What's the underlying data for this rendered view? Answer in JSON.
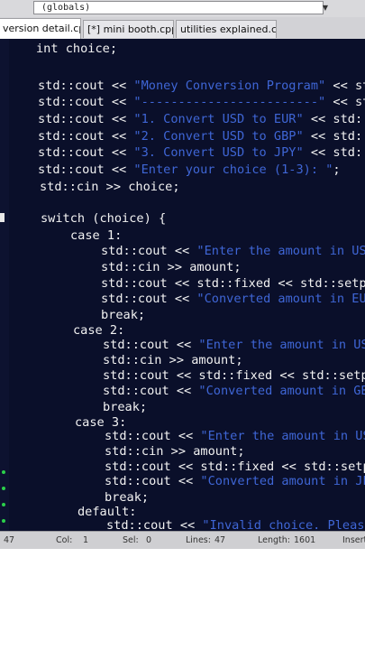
{
  "toolbar": {
    "globals_label": "(globals)",
    "dropdown_arrow": "▼"
  },
  "tabs": [
    {
      "label": "version detail.cpp",
      "active": true
    },
    {
      "label": "[*] mini booth.cpp",
      "active": false
    },
    {
      "label": "utilities explained.cpp",
      "active": false
    }
  ],
  "code": {
    "l1": "int choice;",
    "l2_a": "std::cout << ",
    "l2_s": "\"Money Conversion Program\"",
    "l2_b": " << st",
    "l3_a": "std::cout << ",
    "l3_s": "\"------------------------\"",
    "l3_b": " << st",
    "l4_a": "std::cout << ",
    "l4_s": "\"1. Convert USD to EUR\"",
    "l4_b": " << std::",
    "l5_a": "std::cout << ",
    "l5_s": "\"2. Convert USD to GBP\"",
    "l5_b": " << std::",
    "l6_a": "std::cout << ",
    "l6_s": "\"3. Convert USD to JPY\"",
    "l6_b": " << std::",
    "l7_a": "std::cout << ",
    "l7_s": "\"Enter your choice (1-3): \"",
    "l7_b": ";",
    "l8": "std::cin >> choice;",
    "l9": "switch (choice) {",
    "l10": "case 1:",
    "l11_a": "std::cout << ",
    "l11_s": "\"Enter the amount in USD:",
    "l12": "std::cin >> amount;",
    "l13": "std::cout << std::fixed << std::setpre",
    "l14_a": "std::cout << ",
    "l14_s": "\"Converted amount in EUR:",
    "l15": "break;",
    "l16": "case 2:",
    "l17_a": "std::cout << ",
    "l17_s": "\"Enter the amount in USD:",
    "l18": "std::cin >> amount;",
    "l19": "std::cout << std::fixed << std::setpre",
    "l20_a": "std::cout << ",
    "l20_s": "\"Converted amount in GBP:",
    "l21": "break;",
    "l22": "case 3:",
    "l23_a": "std::cout << ",
    "l23_s": "\"Enter the amount in USD:",
    "l24": "std::cin >> amount;",
    "l25": "std::cout << std::fixed << std::setpre",
    "l26_a": "std::cout << ",
    "l26_s": "\"Converted amount in JPY:",
    "l27": "break;",
    "l28": "default:",
    "l29_a": "std::cout << ",
    "l29_s": "\"Invalid choice. Please se"
  },
  "status": {
    "line_value": "47",
    "col_label": "Col:",
    "col_value": "1",
    "sel_label": "Sel:",
    "sel_value": "0",
    "lines_label": "Lines:",
    "lines_value": "47",
    "length_label": "Length:",
    "length_value": "1601",
    "insert_label": "Insert"
  },
  "colors": {
    "editor_bg": "#0a0f2a",
    "string": "#3f66d6",
    "text": "#f2f2f2",
    "marker": "#2bd04a"
  }
}
